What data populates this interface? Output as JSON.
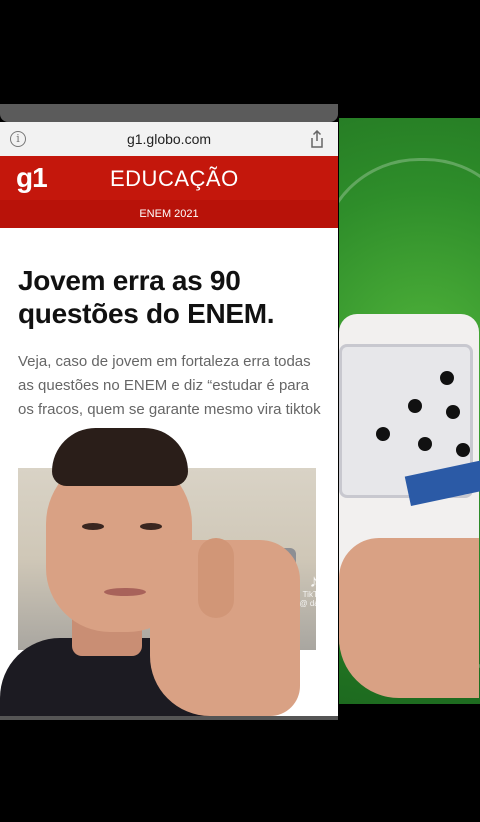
{
  "browser": {
    "url": "g1.globo.com",
    "info_icon": "info-icon",
    "share_icon": "share-icon"
  },
  "header": {
    "logo": "g1",
    "section": "EDUCAÇÃO",
    "subsection": "ENEM 2021"
  },
  "article": {
    "headline": "Jovem erra as 90 questões do ENEM.",
    "lead": "Veja, caso de jovem em fortaleza erra todas as questões no ENEM e diz “estudar é para os fracos, quem se garante mesmo vira tiktok"
  },
  "watermark": {
    "brand": "TikTok",
    "handle": "@ daniii"
  }
}
